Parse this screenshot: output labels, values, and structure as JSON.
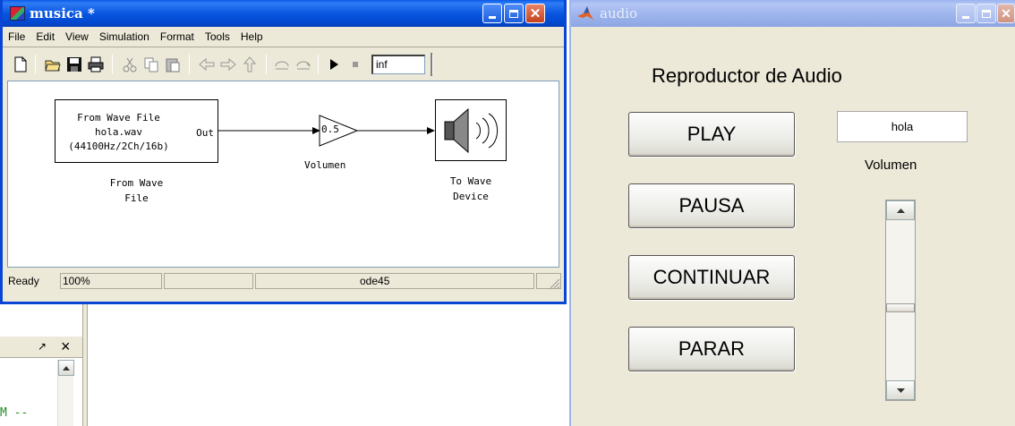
{
  "simulink": {
    "title": "musica *",
    "menu": [
      "File",
      "Edit",
      "View",
      "Simulation",
      "Format",
      "Tools",
      "Help"
    ],
    "stop_time": "inf",
    "blocks": {
      "from_wave": {
        "lines": [
          "From Wave File",
          "hola.wav",
          "(44100Hz/2Ch/16b)"
        ],
        "port": "Out",
        "caption_line1": "From Wave",
        "caption_line2": "File"
      },
      "gain": {
        "value": "0.5",
        "caption": "Volumen"
      },
      "to_wave": {
        "caption_line1": "To Wave",
        "caption_line2": "Device"
      }
    },
    "status": {
      "state": "Ready",
      "zoom": "100%",
      "solver": "ode45"
    }
  },
  "matlab": {
    "panel_glyph_pin": "↗",
    "panel_close": "×",
    "console_text": "M --"
  },
  "audio_gui": {
    "title": "audio",
    "heading": "Reproductor de Audio",
    "buttons": {
      "play": "PLAY",
      "pause": "PAUSA",
      "continue": "CONTINUAR",
      "stop": "PARAR"
    },
    "text_field": "hola",
    "volume_label": "Volumen",
    "slider_level": 0.55
  },
  "colors": {
    "xp_blue": "#0a46d6",
    "window_bg": "#ece9d8",
    "console_green": "#228b22"
  }
}
